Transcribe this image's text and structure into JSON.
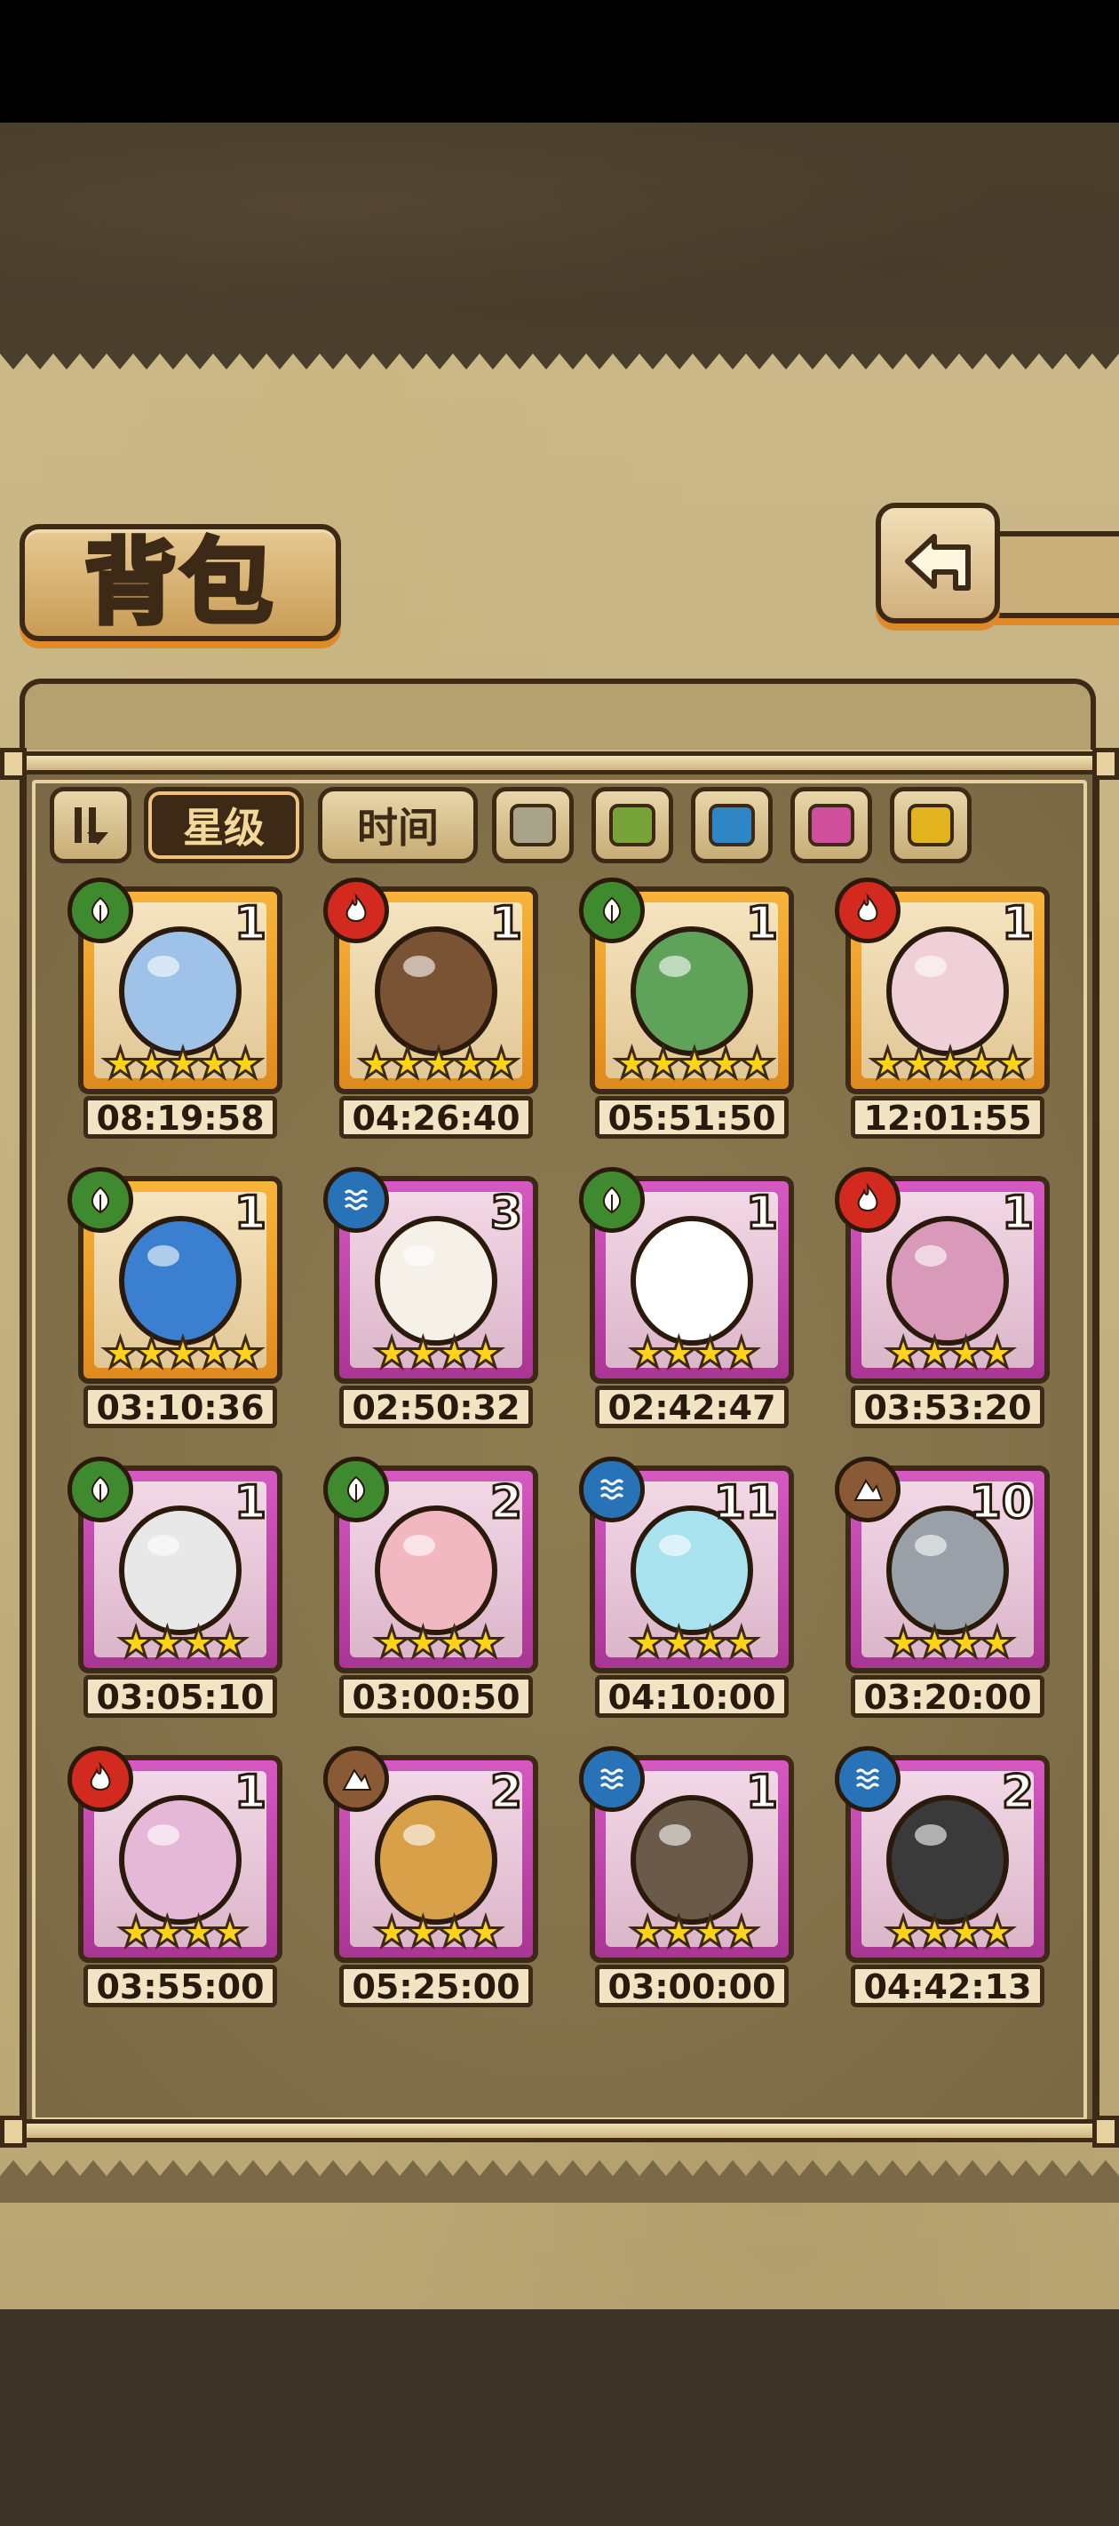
{
  "header": {
    "title": "背包",
    "back_icon": "back-arrow-icon"
  },
  "filters": {
    "sort_toggle_icon": "sort-toggle-icon",
    "sort_by_rarity": "星级",
    "sort_by_time": "时间",
    "colors": [
      {
        "name": "gray",
        "hex": "#a7a48a"
      },
      {
        "name": "green",
        "hex": "#78a23a"
      },
      {
        "name": "blue",
        "hex": "#2f86c6"
      },
      {
        "name": "pink",
        "hex": "#d04f9a"
      },
      {
        "name": "yellow",
        "hex": "#e2b420"
      }
    ],
    "active": "sort_by_rarity"
  },
  "items": [
    {
      "element": "leaf",
      "icon": "pocket-watch-icon",
      "count": "1",
      "stars": 5,
      "rarity": "gold",
      "timer": "08:19:58"
    },
    {
      "element": "fire",
      "icon": "bow-and-quiver-icon",
      "count": "1",
      "stars": 5,
      "rarity": "gold",
      "timer": "04:26:40"
    },
    {
      "element": "leaf",
      "icon": "lantern-icon",
      "count": "1",
      "stars": 5,
      "rarity": "gold",
      "timer": "05:51:50"
    },
    {
      "element": "fire",
      "icon": "scorpion-egg-icon",
      "count": "1",
      "stars": 5,
      "rarity": "gold",
      "timer": "12:01:55"
    },
    {
      "element": "leaf",
      "icon": "eyeball-creature-icon",
      "count": "1",
      "stars": 5,
      "rarity": "gold",
      "timer": "03:10:36"
    },
    {
      "element": "water",
      "icon": "winged-leaf-egg-icon",
      "count": "3",
      "stars": 4,
      "rarity": "purple",
      "timer": "02:50:32"
    },
    {
      "element": "leaf",
      "icon": "white-egg-icon",
      "count": "1",
      "stars": 4,
      "rarity": "purple",
      "timer": "02:42:47"
    },
    {
      "element": "fire",
      "icon": "pink-bat-egg-icon",
      "count": "1",
      "stars": 4,
      "rarity": "purple",
      "timer": "03:53:20"
    },
    {
      "element": "leaf",
      "icon": "horned-orb-icon",
      "count": "1",
      "stars": 4,
      "rarity": "purple",
      "timer": "03:05:10"
    },
    {
      "element": "leaf",
      "icon": "pink-creature-icon",
      "count": "2",
      "stars": 4,
      "rarity": "purple",
      "timer": "03:00:50"
    },
    {
      "element": "water",
      "icon": "water-slime-icon",
      "count": "11",
      "stars": 4,
      "rarity": "purple",
      "timer": "04:10:00"
    },
    {
      "element": "earth",
      "icon": "sword-icon",
      "count": "10",
      "stars": 4,
      "rarity": "purple",
      "timer": "03:20:00"
    },
    {
      "element": "fire",
      "icon": "heart-bat-egg-icon",
      "count": "1",
      "stars": 4,
      "rarity": "purple",
      "timer": "03:55:00"
    },
    {
      "element": "earth",
      "icon": "furry-beast-icon",
      "count": "2",
      "stars": 4,
      "rarity": "purple",
      "timer": "05:25:00"
    },
    {
      "element": "water",
      "icon": "helmet-egg-icon",
      "count": "1",
      "stars": 4,
      "rarity": "purple",
      "timer": "03:00:00"
    },
    {
      "element": "water",
      "icon": "black-spiky-egg-icon",
      "count": "2",
      "stars": 4,
      "rarity": "purple",
      "timer": "04:42:13"
    }
  ]
}
